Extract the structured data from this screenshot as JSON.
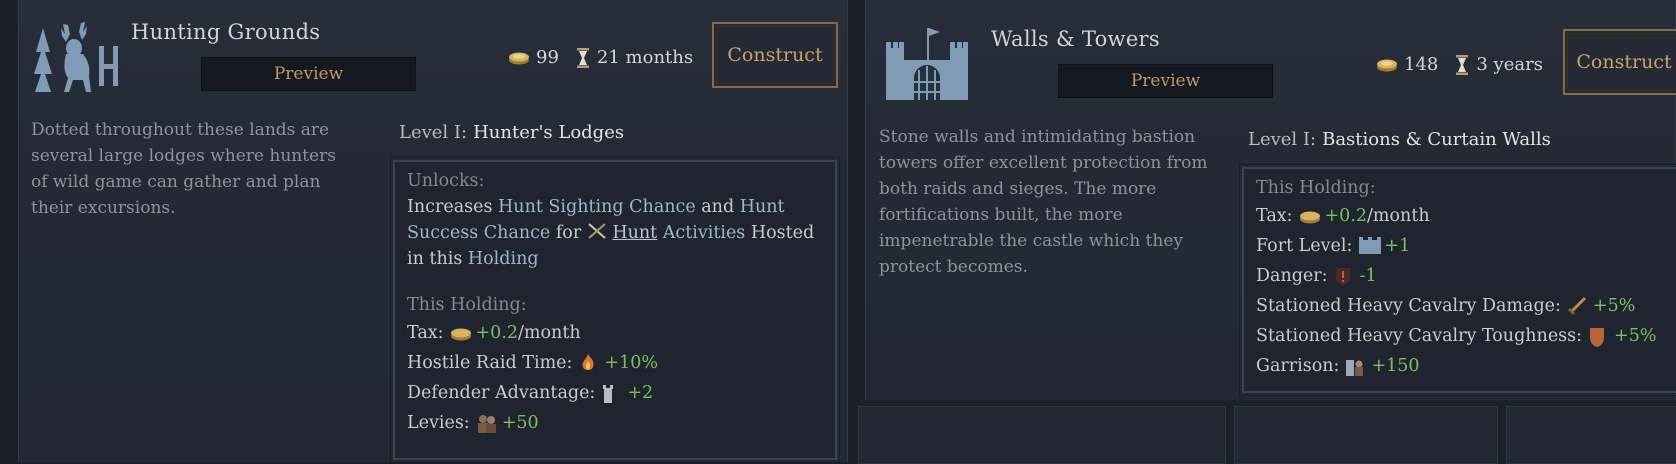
{
  "left": {
    "title": "Hunting Grounds",
    "preview_label": "Preview",
    "cost_gold": "99",
    "cost_time": "21 months",
    "construct_label": "Construct",
    "description": "Dotted throughout these lands are several large lodges where hunters of wild game can gather and plan their excursions.",
    "level_prefix": "Level I:",
    "level_name": "Hunter's Lodges",
    "unlocks_label": "Unlocks:",
    "unlocks": {
      "t1": "Increases ",
      "hunt_sighting": "Hunt Sighting Chance",
      "t2": " and ",
      "hunt_success": "Hunt Success Chance",
      "t3": " for ",
      "hunt": "Hunt",
      "activities": " Activities",
      "t4": " Hosted in this ",
      "holding": "Holding"
    },
    "holding_label": "This Holding:",
    "effects": [
      {
        "label": "Tax:",
        "value": "+0.2",
        "suffix": "/month",
        "icon": "gold-coins-icon"
      },
      {
        "label": "Hostile Raid Time:",
        "value": "+10%",
        "suffix": "",
        "icon": "fire-raid-icon"
      },
      {
        "label": "Defender Advantage:",
        "value": "+2",
        "suffix": "",
        "icon": "tower-icon"
      },
      {
        "label": "Levies:",
        "value": "+50",
        "suffix": "",
        "icon": "levies-icon"
      }
    ]
  },
  "right": {
    "title": "Walls & Towers",
    "preview_label": "Preview",
    "cost_gold": "148",
    "cost_time": "3 years",
    "construct_label": "Construct",
    "description": "Stone walls and intimidating bastion towers offer excellent protection from both raids and sieges. The more fortifications built, the more impenetrable the castle which they protect becomes.",
    "level_prefix": "Level I:",
    "level_name": "Bastions & Curtain Walls",
    "holding_label": "This Holding:",
    "effects": [
      {
        "label": "Tax:",
        "value": "+0.2",
        "suffix": "/month",
        "icon": "gold-coins-icon"
      },
      {
        "label": "Fort Level:",
        "value": "+1",
        "suffix": "",
        "icon": "fort-icon"
      },
      {
        "label": "Danger:",
        "value": "-1",
        "suffix": "",
        "icon": "danger-shield-icon"
      },
      {
        "label": "Stationed Heavy Cavalry Damage:",
        "value": "+5%",
        "suffix": "",
        "icon": "sword-icon"
      },
      {
        "label": "Stationed Heavy Cavalry Toughness:",
        "value": "+5%",
        "suffix": "",
        "icon": "shield-icon"
      },
      {
        "label": "Garrison:",
        "value": "+150",
        "suffix": "",
        "icon": "garrison-icon"
      }
    ]
  },
  "colors": {
    "gold_text": "#c49a5c",
    "bonus_green": "#7cc05c",
    "highlight_blue": "#9fb6cb"
  }
}
